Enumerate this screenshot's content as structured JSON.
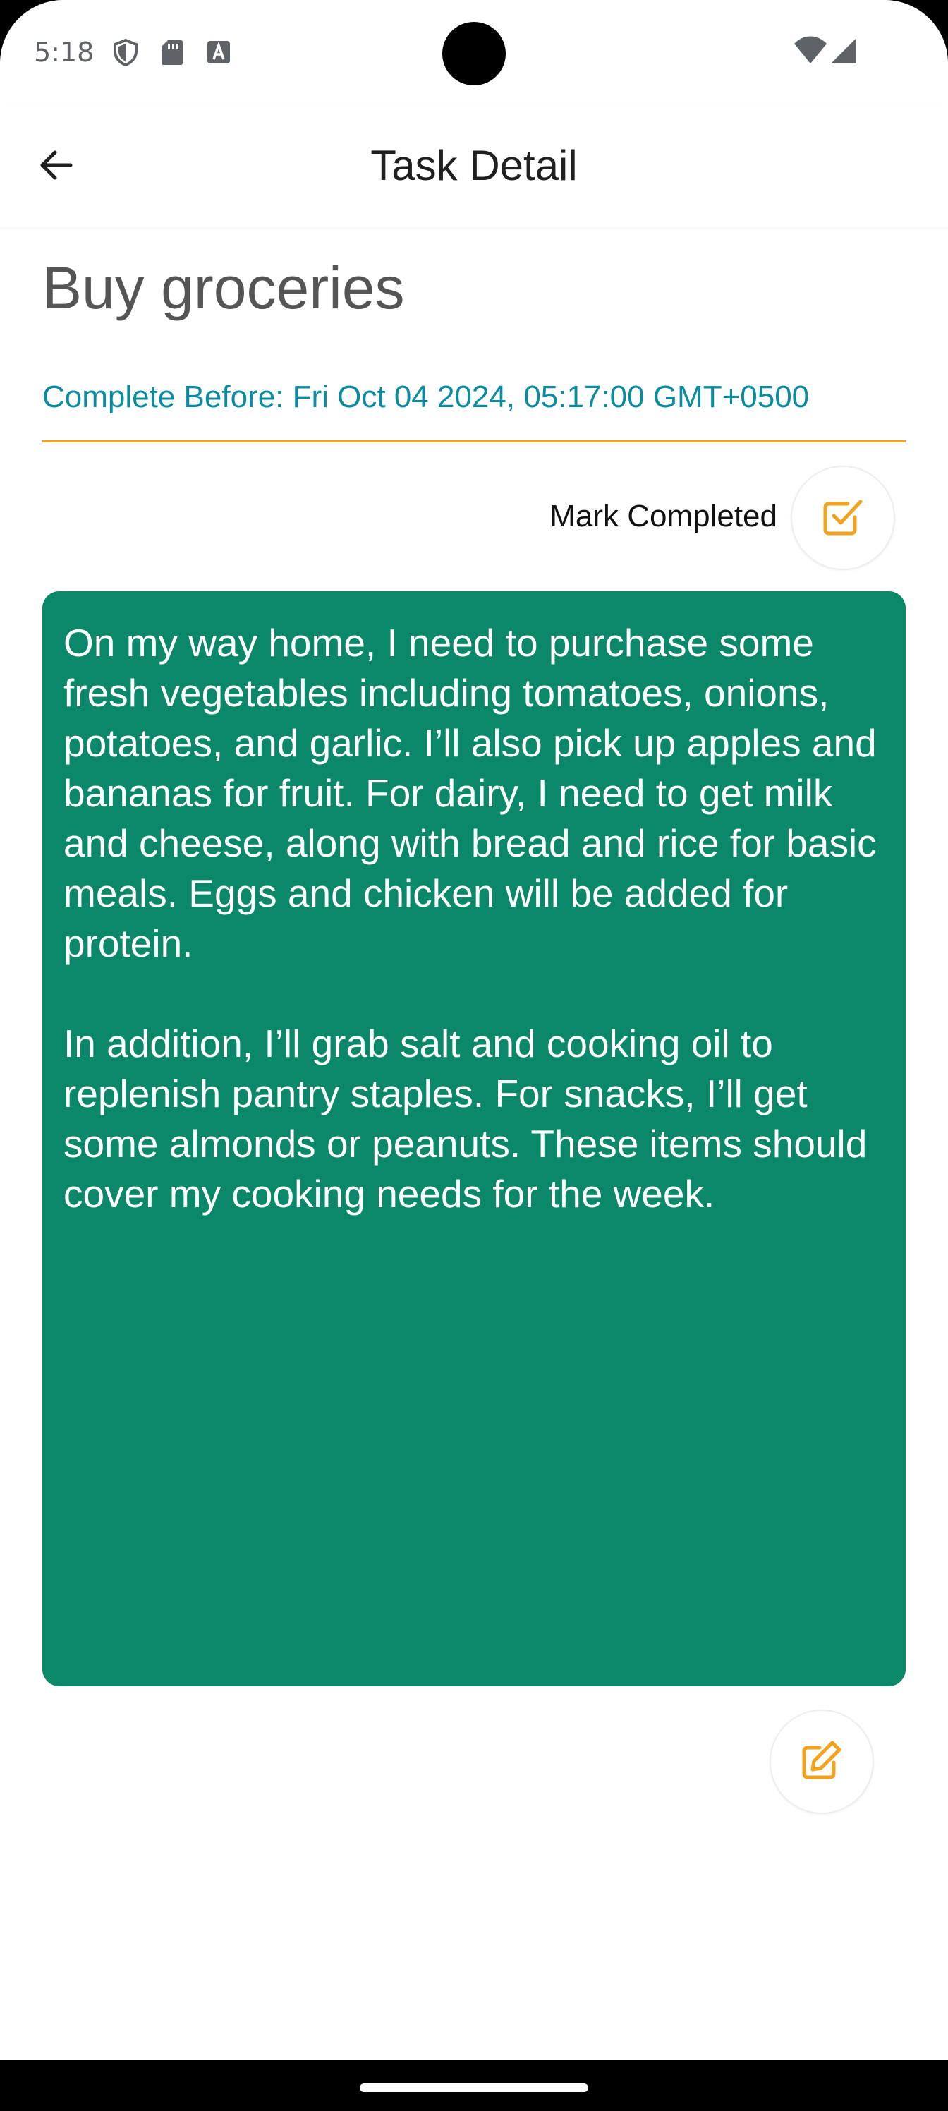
{
  "status_bar": {
    "time": "5:18",
    "left_icons": [
      "shield-icon",
      "sd-card-icon",
      "font-a-icon"
    ],
    "right_icons": [
      "wifi-icon",
      "cellular-signal-icon"
    ]
  },
  "app_bar": {
    "title": "Task Detail",
    "back_icon": "arrow-left-icon"
  },
  "task": {
    "title": "Buy groceries",
    "due_label": "Complete Before: Fri Oct 04 2024, 05:17:00 GMT+0500",
    "mark_completed_label": "Mark Completed",
    "description_paragraphs": [
      "On my way home, I need to purchase some fresh vegetables including tomatoes, onions, potatoes, and garlic. I’ll also pick up apples and bananas for fruit. For dairy, I need to get milk and cheese, along with bread and rice for basic meals. Eggs and chicken will be added for protein.",
      "In addition, I’ll grab salt and cooking oil to replenish pantry staples. For snacks, I’ll get some almonds or peanuts. These items should cover my cooking needs for the week."
    ]
  },
  "colors": {
    "accent": "#f2a21b",
    "due_date_text": "#0b8ba0",
    "card_background": "#0b8769",
    "title_text": "#555555"
  },
  "icons": {
    "mark_completed": "checkbox-checked-icon",
    "edit": "edit-note-icon"
  }
}
